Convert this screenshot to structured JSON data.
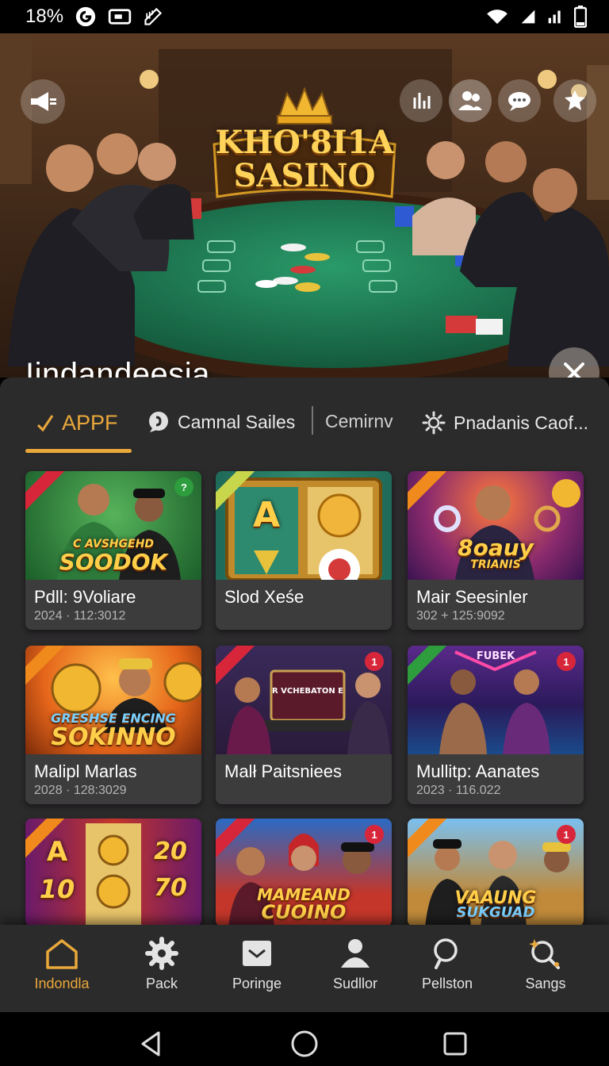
{
  "status_bar": {
    "battery_percent": "18%",
    "icons": [
      "g-logo-icon",
      "cast-icon",
      "sim-edit-icon",
      "wifi-icon",
      "signal-icon",
      "signal-icon-2",
      "battery-icon"
    ]
  },
  "hero": {
    "logo_line1": "KHO'8I1A",
    "logo_line2": "SASINO",
    "title": "Iindandeesia",
    "left_button_icon": "megaphone-icon",
    "right_buttons": [
      "chart-icon",
      "users-icon",
      "chat-icon",
      "badge-icon"
    ],
    "close_icon": "close-icon"
  },
  "tabs": [
    {
      "label": "APPF",
      "icon": "check-icon",
      "active": true
    },
    {
      "label": "Camnal Sailes",
      "icon": "chat-bubble-icon",
      "active": false
    },
    {
      "label": "Cemirnv",
      "icon": "",
      "active": false
    },
    {
      "label": "Pnadanis Caof...",
      "icon": "settings-icon",
      "active": false
    }
  ],
  "cards": [
    {
      "title": "Pdll: 9Voliare",
      "subtitle": "2024 · 112:3012",
      "thumb_line1": "C AVSHGEHD",
      "thumb_line2": "SOODOK",
      "badge": "?",
      "badge_color": "#2e9d3d",
      "ribbon_color": "#d7263a",
      "theme": "green"
    },
    {
      "title": "Slod Xeśe",
      "subtitle": "",
      "thumb_line1": "A",
      "thumb_line2": "",
      "badge": "",
      "badge_color": "",
      "ribbon_color": "#c8d64b",
      "theme": "slots-gold"
    },
    {
      "title": "Mair Seesinler",
      "subtitle": "302 + 125:9092",
      "thumb_line1": "8oauy",
      "thumb_line2": "TRIANIS",
      "badge": "",
      "badge_color": "",
      "ribbon_color": "#f08a1c",
      "theme": "purple"
    },
    {
      "title": "Malipl Marlas",
      "subtitle": "2028 · 128:3029",
      "thumb_line1": "GRESHSE ENCING",
      "thumb_line2": "SOKINNO",
      "badge": "",
      "badge_color": "",
      "ribbon_color": "#f08a1c",
      "theme": "orange"
    },
    {
      "title": "Malł Paitsniees",
      "subtitle": "",
      "thumb_line1": "R VCHEBATON E",
      "thumb_line2": "",
      "badge": "1",
      "badge_color": "#d7263a",
      "ribbon_color": "#d7263a",
      "theme": "dark-purple"
    },
    {
      "title": "Mullitp: Aanates",
      "subtitle": "2023 · 116.022",
      "thumb_line1": "FUBEK",
      "thumb_line2": "",
      "badge": "1",
      "badge_color": "#d7263a",
      "ribbon_color": "#2e9d3d",
      "theme": "neon"
    },
    {
      "title": "",
      "subtitle": "",
      "thumb_line1": "A",
      "thumb_line2": "10",
      "thumb_line3": "20",
      "thumb_line4": "70",
      "badge": "",
      "badge_color": "",
      "ribbon_color": "#f08a1c",
      "theme": "slots-red"
    },
    {
      "title": "",
      "subtitle": "",
      "thumb_line1": "MAMEAND",
      "thumb_line2": "CUOINO",
      "badge": "1",
      "badge_color": "#d7263a",
      "ribbon_color": "#d7263a",
      "theme": "red-people"
    },
    {
      "title": "",
      "subtitle": "",
      "thumb_line1": "VAAUNG",
      "thumb_line2": "SUKGUAD",
      "badge": "1",
      "badge_color": "#d7263a",
      "ribbon_color": "#f08a1c",
      "theme": "sky"
    }
  ],
  "bottom_nav": [
    {
      "label": "Indondla",
      "icon": "home-icon",
      "active": true
    },
    {
      "label": "Pack",
      "icon": "gear-icon",
      "active": false
    },
    {
      "label": "Poringe",
      "icon": "inbox-icon",
      "active": false
    },
    {
      "label": "Sudllor",
      "icon": "person-icon",
      "active": false
    },
    {
      "label": "Pellston",
      "icon": "search-icon",
      "active": false
    },
    {
      "label": "Sangs",
      "icon": "magic-search-icon",
      "active": false
    }
  ],
  "system_nav": [
    "back-icon",
    "home-circle-icon",
    "recents-icon"
  ],
  "colors": {
    "accent": "#e9a83a",
    "panel": "#2c2b2c",
    "card": "#3d3c3d",
    "table_felt": "#1f7a55"
  }
}
